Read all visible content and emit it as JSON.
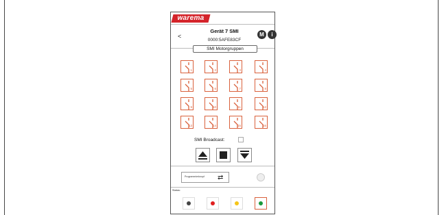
{
  "header": {
    "brand": "warema",
    "back": "<",
    "title": "Gerät 7 SMI",
    "serial": "0000:5AFE83CF",
    "mode_button": "M",
    "info_button": "i"
  },
  "tab": {
    "label": "SMI Motorgruppen"
  },
  "motors": [
    "1",
    "2",
    "3",
    "4",
    "5",
    "6",
    "7",
    "8",
    "9",
    "10",
    "11",
    "12",
    "13",
    "14",
    "15",
    "16"
  ],
  "broadcast": {
    "label": "SMI Broadcast:",
    "checked": false
  },
  "controls": {
    "up": "up-icon",
    "stop": "stop-icon",
    "down": "down-icon"
  },
  "program": {
    "label": "Programmierknopf",
    "icon": "swap-arrows-icon"
  },
  "status": {
    "label": "Status:",
    "leds": [
      {
        "name": "gray",
        "color": "#444444"
      },
      {
        "name": "red",
        "color": "#e02020"
      },
      {
        "name": "yellow",
        "color": "#f5c518"
      },
      {
        "name": "green",
        "color": "#1a9a3a"
      }
    ]
  },
  "colors": {
    "accent": "#d4232a",
    "motor_border": "#d9603b"
  }
}
